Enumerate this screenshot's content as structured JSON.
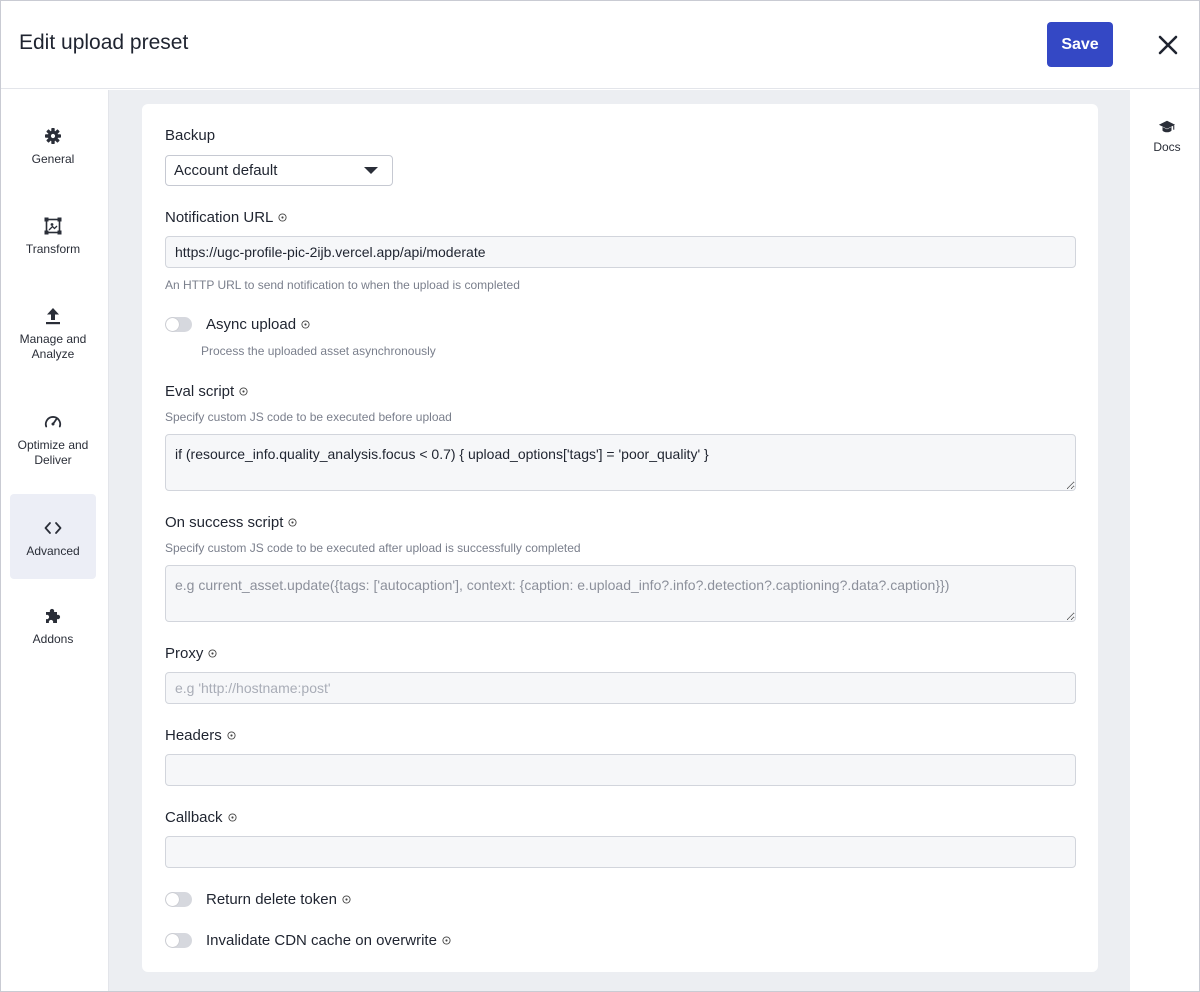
{
  "header": {
    "title": "Edit upload preset",
    "save_label": "Save"
  },
  "colors": {
    "accent": "#3448c5",
    "panel_bg": "#eceef2",
    "active_nav_bg": "#eceef6"
  },
  "sidebar": {
    "items": [
      {
        "label": "General",
        "icon": "gear-icon",
        "active": false
      },
      {
        "label": "Transform",
        "icon": "crop-icon",
        "active": false
      },
      {
        "label": "Manage and Analyze",
        "icon": "upload-icon",
        "active": false
      },
      {
        "label": "Optimize and Deliver",
        "icon": "gauge-icon",
        "active": false
      },
      {
        "label": "Advanced",
        "icon": "code-icon",
        "active": true
      },
      {
        "label": "Addons",
        "icon": "puzzle-icon",
        "active": false
      }
    ]
  },
  "rightnav": {
    "docs_label": "Docs",
    "docs_icon": "graduation-cap-icon"
  },
  "form": {
    "backup": {
      "label": "Backup",
      "value": "Account default"
    },
    "notification_url": {
      "label": "Notification URL",
      "value": "https://ugc-profile-pic-2ijb.vercel.app/api/moderate",
      "help": "An HTTP URL to send notification to when the upload is completed"
    },
    "async_upload": {
      "label": "Async upload",
      "help": "Process the uploaded asset asynchronously",
      "on": false
    },
    "eval_script": {
      "label": "Eval script",
      "help": "Specify custom JS code to be executed before upload",
      "value": "if (resource_info.quality_analysis.focus < 0.7) { upload_options['tags'] = 'poor_quality' }"
    },
    "on_success_script": {
      "label": "On success script",
      "help": "Specify custom JS code to be executed after upload is successfully completed",
      "placeholder": "e.g current_asset.update({tags: ['autocaption'], context: {caption: e.upload_info?.info?.detection?.captioning?.data?.caption}})"
    },
    "proxy": {
      "label": "Proxy",
      "placeholder": "e.g 'http://hostname:post'"
    },
    "headers": {
      "label": "Headers",
      "value": ""
    },
    "callback": {
      "label": "Callback",
      "value": ""
    },
    "return_delete_token": {
      "label": "Return delete token",
      "on": false
    },
    "invalidate_cdn": {
      "label": "Invalidate CDN cache on overwrite",
      "on": false
    }
  }
}
